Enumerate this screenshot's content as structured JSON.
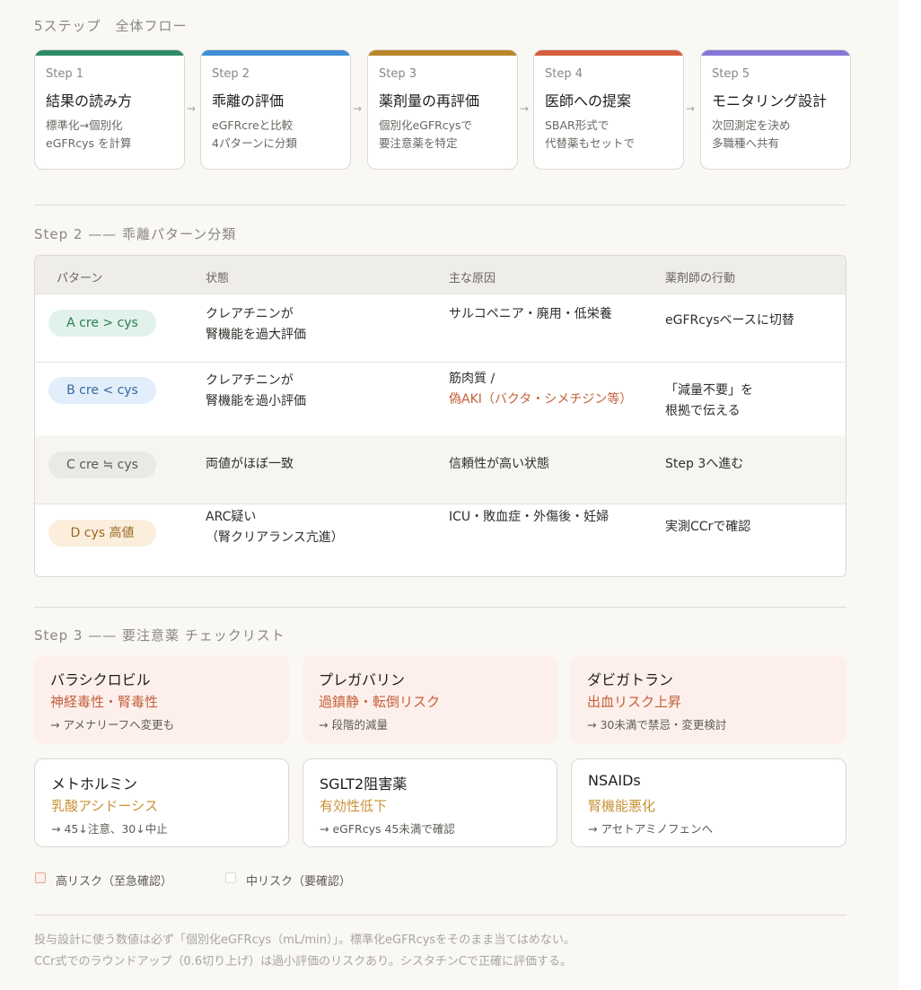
{
  "flow": {
    "label": "5ステップ　全体フロー",
    "arrow": "→",
    "steps": [
      {
        "num": "Step 1",
        "title": "結果の読み方",
        "desc1": "標準化→個別化",
        "desc2": "eGFRcys を計算",
        "color": "#2e8b6a"
      },
      {
        "num": "Step 2",
        "title": "乖離の評価",
        "desc1": "eGFRcreと比較",
        "desc2": "4パターンに分類",
        "color": "#3f8ed6"
      },
      {
        "num": "Step 3",
        "title": "薬剤量の再評価",
        "desc1": "個別化eGFRcysで",
        "desc2": "要注意薬を特定",
        "color": "#b8862a"
      },
      {
        "num": "Step 4",
        "title": "医師への提案",
        "desc1": "SBAR形式で",
        "desc2": "代替薬もセットで",
        "color": "#d35f3d"
      },
      {
        "num": "Step 5",
        "title": "モニタリング設計",
        "desc1": "次回測定を決め",
        "desc2": "多職種へ共有",
        "color": "#8378d6"
      }
    ]
  },
  "step2": {
    "label": "Step 2 —— 乖離パターン分類",
    "headers": [
      "パターン",
      "状態",
      "主な原因",
      "薬剤師の行動"
    ],
    "rows": [
      {
        "pattern": "A cre > cys",
        "pill_bg": "#e0f2ea",
        "pill_fg": "#2e7a5d",
        "state1": "クレアチニンが",
        "state2": "腎機能を過大評価",
        "cause1": "サルコペニア・廃用・低栄養",
        "cause2": "",
        "action1": "eGFRcysベースに切替",
        "action2": ""
      },
      {
        "pattern": "B cre < cys",
        "pill_bg": "#e3eefb",
        "pill_fg": "#34689e",
        "state1": "クレアチニンが",
        "state2": "腎機能を過小評価",
        "cause1": "筋肉質 /",
        "cause2": "偽AKI（バクタ・シメチジン等）",
        "action1": "「減量不要」を",
        "action2": "根拠で伝える"
      },
      {
        "pattern": "C cre ≒ cys",
        "pill_bg": "#ebe9e4",
        "pill_fg": "#5a5853",
        "state1": "両値がほぼ一致",
        "state2": "",
        "cause1": "信頼性が高い状態",
        "cause2": "",
        "action1": "Step 3へ進む",
        "action2": ""
      },
      {
        "pattern": "D cys 高値",
        "pill_bg": "#fbeedd",
        "pill_fg": "#9a6a1e",
        "state1": "ARC疑い",
        "state2": "（腎クリアランス亢進）",
        "cause1": "ICU・敗血症・外傷後・妊婦",
        "cause2": "",
        "action1": "実測CCrで確認",
        "action2": ""
      }
    ]
  },
  "step3": {
    "label": "Step 3 —— 要注意薬 チェックリスト",
    "cards": [
      {
        "title": "バラシクロビル",
        "risk": "神経毒性・腎毒性",
        "note": "→ アメナリーフへ変更も",
        "level": "high"
      },
      {
        "title": "プレガバリン",
        "risk": "過鎮静・転倒リスク",
        "note": "→ 段階的減量",
        "level": "high"
      },
      {
        "title": "ダビガトラン",
        "risk": "出血リスク上昇",
        "note": "→ 30未満で禁忌・変更検討",
        "level": "high"
      },
      {
        "title": "メトホルミン",
        "risk": "乳酸アシドーシス",
        "note": "→ 45↓注意、30↓中止",
        "level": "mid"
      },
      {
        "title": "SGLT2阻害薬",
        "risk": "有効性低下",
        "note": "→ eGFRcys 45未満で確認",
        "level": "mid"
      },
      {
        "title": "NSAIDs",
        "risk": "腎機能悪化",
        "note": "→ アセトアミノフェンへ",
        "level": "mid"
      }
    ],
    "legend": [
      {
        "text": "高リスク（至急確認）",
        "color": "#e6a391"
      },
      {
        "text": "中リスク（要確認）",
        "color": "#dcd9d2"
      }
    ]
  },
  "footer": {
    "line1": "投与設計に使う数値は必ず「個別化eGFRcys（mL/min）」。標準化eGFRcysをそのまま当てはめない。",
    "line2": "CCr式でのラウンドアップ（0.6切り上げ）は過小評価のリスクあり。シスタチンCで正確に評価する。"
  }
}
